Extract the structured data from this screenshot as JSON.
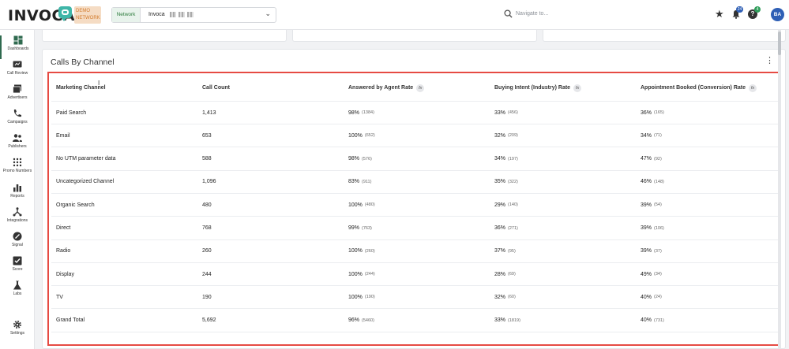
{
  "brand": {
    "logo_text": "INVOCA",
    "badge_line1": "DEMO",
    "badge_line2": "NETWORK"
  },
  "network": {
    "label": "Network",
    "value": "Invoca"
  },
  "nav_search": {
    "placeholder": "Navigate to..."
  },
  "notifications": {
    "bell_count": "24",
    "help_count": "4"
  },
  "user": {
    "initials": "BA"
  },
  "sidebar": {
    "items": [
      {
        "label": "Dashboards",
        "icon": "dashboard-icon",
        "active": true
      },
      {
        "label": "Call Review",
        "icon": "call-review-icon"
      },
      {
        "label": "Advertisers",
        "icon": "advertisers-icon"
      },
      {
        "label": "Campaigns",
        "icon": "campaigns-icon"
      },
      {
        "label": "Publishers",
        "icon": "publishers-icon"
      },
      {
        "label": "Promo Numbers",
        "icon": "promo-numbers-icon"
      },
      {
        "label": "Reports",
        "icon": "reports-icon"
      },
      {
        "label": "Integrations",
        "icon": "integrations-icon"
      },
      {
        "label": "Signal",
        "icon": "signal-icon"
      },
      {
        "label": "Score",
        "icon": "score-icon"
      },
      {
        "label": "Labs",
        "icon": "labs-icon"
      },
      {
        "label": "Settings",
        "icon": "gear-icon"
      }
    ]
  },
  "card": {
    "title": "Calls By Channel",
    "columns": [
      {
        "label": "Marketing Channel",
        "formula": false
      },
      {
        "label": "Call Count",
        "formula": false
      },
      {
        "label": "Answered by Agent Rate",
        "formula": true
      },
      {
        "label": "Buying Intent (Industry) Rate",
        "formula": true
      },
      {
        "label": "Appointment Booked (Conversion) Rate",
        "formula": true
      }
    ],
    "formula_symbol": "fx",
    "rows": [
      {
        "channel": "Paid Search",
        "count": "1,413",
        "answered": "98%",
        "answered_n": "(1384)",
        "intent": "33%",
        "intent_n": "(456)",
        "booked": "36%",
        "booked_n": "(165)"
      },
      {
        "channel": "Email",
        "count": "653",
        "answered": "100%",
        "answered_n": "(652)",
        "intent": "32%",
        "intent_n": "(209)",
        "booked": "34%",
        "booked_n": "(71)"
      },
      {
        "channel": "No UTM parameter data",
        "count": "588",
        "answered": "98%",
        "answered_n": "(576)",
        "intent": "34%",
        "intent_n": "(197)",
        "booked": "47%",
        "booked_n": "(92)"
      },
      {
        "channel": "Uncategorized Channel",
        "count": "1,096",
        "answered": "83%",
        "answered_n": "(911)",
        "intent": "35%",
        "intent_n": "(322)",
        "booked": "46%",
        "booked_n": "(148)"
      },
      {
        "channel": "Organic Search",
        "count": "480",
        "answered": "100%",
        "answered_n": "(480)",
        "intent": "29%",
        "intent_n": "(140)",
        "booked": "39%",
        "booked_n": "(54)"
      },
      {
        "channel": "Direct",
        "count": "768",
        "answered": "99%",
        "answered_n": "(763)",
        "intent": "36%",
        "intent_n": "(271)",
        "booked": "39%",
        "booked_n": "(106)"
      },
      {
        "channel": "Radio",
        "count": "260",
        "answered": "100%",
        "answered_n": "(260)",
        "intent": "37%",
        "intent_n": "(95)",
        "booked": "39%",
        "booked_n": "(37)"
      },
      {
        "channel": "Display",
        "count": "244",
        "answered": "100%",
        "answered_n": "(244)",
        "intent": "28%",
        "intent_n": "(69)",
        "booked": "49%",
        "booked_n": "(34)"
      },
      {
        "channel": "TV",
        "count": "190",
        "answered": "100%",
        "answered_n": "(190)",
        "intent": "32%",
        "intent_n": "(60)",
        "booked": "40%",
        "booked_n": "(24)"
      },
      {
        "channel": "Grand Total",
        "count": "5,692",
        "answered": "96%",
        "answered_n": "(5460)",
        "intent": "33%",
        "intent_n": "(1819)",
        "booked": "40%",
        "booked_n": "(731)"
      }
    ]
  },
  "colors": {
    "highlight_border": "#e64b43",
    "brand_green": "#3fb6a8",
    "accent_blue": "#2f5fb5"
  }
}
